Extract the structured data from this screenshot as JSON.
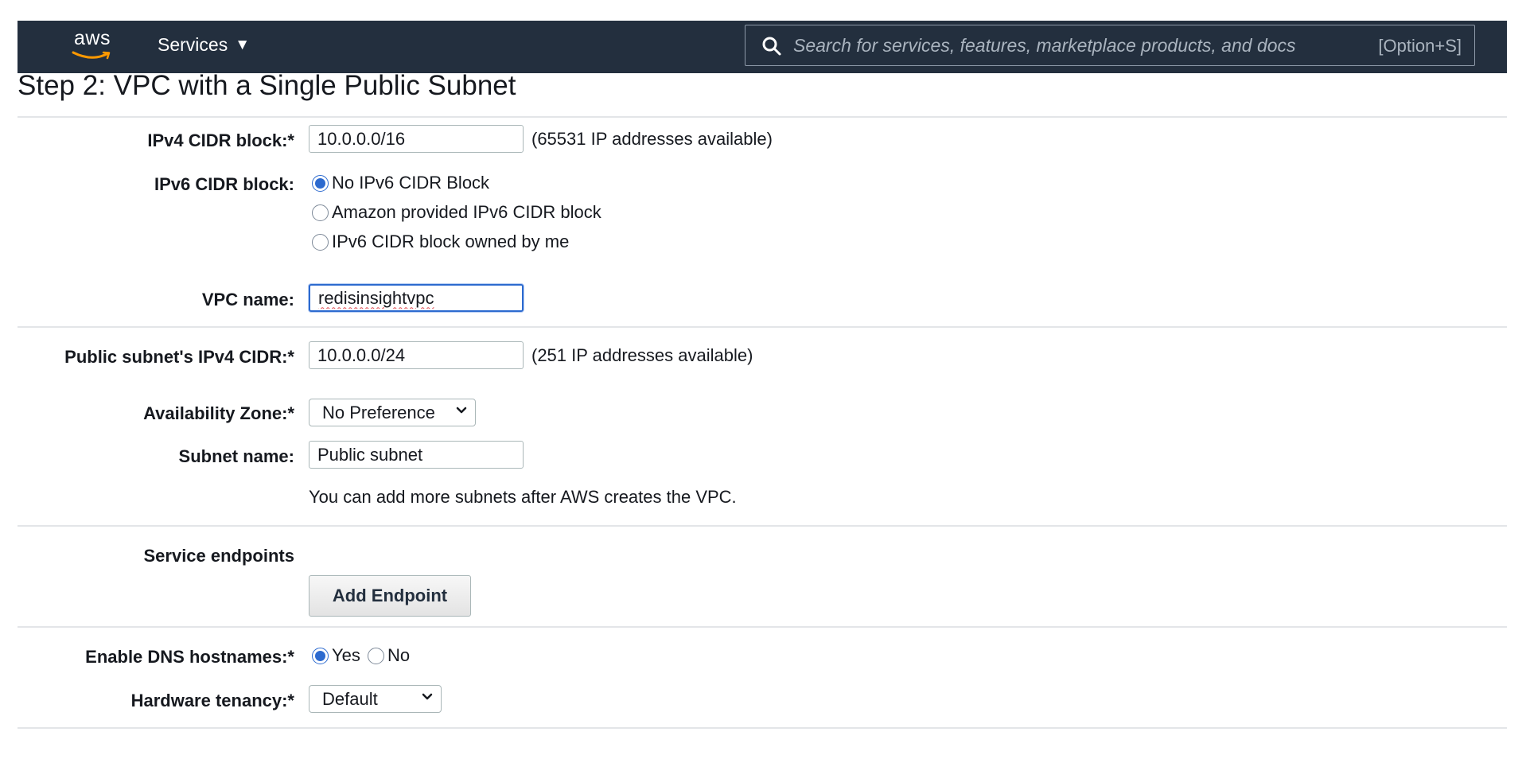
{
  "header": {
    "logo_text": "aws",
    "services_label": "Services",
    "services_caret": "▼",
    "search_placeholder": "Search for services, features, marketplace products, and docs",
    "search_shortcut": "[Option+S]"
  },
  "page": {
    "title": "Step 2: VPC with a Single Public Subnet"
  },
  "form": {
    "ipv4_cidr": {
      "label": "IPv4 CIDR block:*",
      "value": "10.0.0.0/16",
      "hint": "(65531 IP addresses available)"
    },
    "ipv6_cidr": {
      "label": "IPv6 CIDR block:",
      "options": [
        {
          "label": "No IPv6 CIDR Block",
          "selected": true
        },
        {
          "label": "Amazon provided IPv6 CIDR block",
          "selected": false
        },
        {
          "label": "IPv6 CIDR block owned by me",
          "selected": false
        }
      ]
    },
    "vpc_name": {
      "label": "VPC name:",
      "value": "redisinsightvpc"
    },
    "public_subnet_cidr": {
      "label": "Public subnet's IPv4 CIDR:*",
      "value": "10.0.0.0/24",
      "hint": "(251 IP addresses available)"
    },
    "availability_zone": {
      "label": "Availability Zone:*",
      "value": "No Preference"
    },
    "subnet_name": {
      "label": "Subnet name:",
      "value": "Public subnet",
      "note": "You can add more subnets after AWS creates the VPC."
    },
    "service_endpoints": {
      "label": "Service endpoints",
      "button": "Add Endpoint"
    },
    "dns_hostnames": {
      "label": "Enable DNS hostnames:*",
      "options": [
        {
          "label": "Yes",
          "selected": true
        },
        {
          "label": "No",
          "selected": false
        }
      ]
    },
    "hardware_tenancy": {
      "label": "Hardware tenancy:*",
      "value": "Default"
    }
  },
  "colors": {
    "header_bg": "#232f3e",
    "focus_blue": "#2c6acf",
    "divider": "#e3e5e8"
  },
  "icons": {
    "logo_smile": "aws-smile-icon",
    "search": "search-icon",
    "select_chevron": "chevron-down-icon"
  }
}
